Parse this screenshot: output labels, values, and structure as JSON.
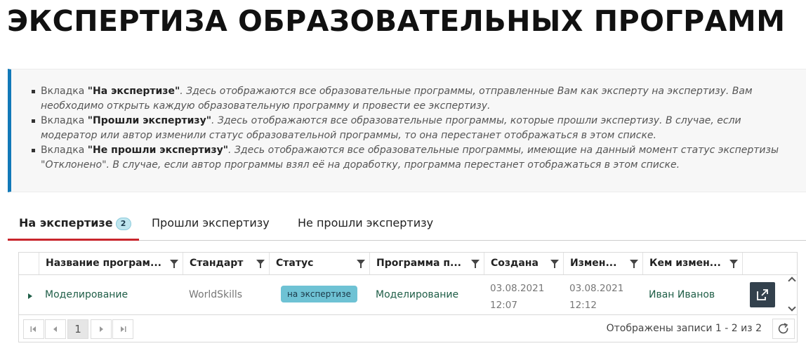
{
  "page": {
    "title": "ЭКСПЕРТИЗА ОБРАЗОВАТЕЛЬНЫХ ПРОГРАММ"
  },
  "info": {
    "items": [
      {
        "prefix": "Вкладка ",
        "bold": "\"На экспертизе\"",
        "text": ". Здесь отображаются все образовательные программы, отправленные Вам как эксперту на экспертизу. Вам необходимо открыть каждую образовательную программу и провести ее экспертизу."
      },
      {
        "prefix": "Вкладка ",
        "bold": "\"Прошли экспертизу\"",
        "text": ". Здесь отображаются все образовательные программы, которые прошли экспертизу. В случае, если модератор или автор изменили статус образовательной программы, то она перестанет отображаться в этом списке."
      },
      {
        "prefix": "Вкладка ",
        "bold": "\"Не прошли экспертизу\"",
        "text": ". Здесь отображаются все образовательные программы, имеющие на данный момент статус экспертизы \"Отклонено\". В случае, если автор программы взял её на доработку, программа перестанет отображаться в этом списке."
      }
    ]
  },
  "tabs": [
    {
      "label": "На экспертизе",
      "count": "2",
      "active": true
    },
    {
      "label": "Прошли экспертизу",
      "active": false
    },
    {
      "label": "Не прошли экспертизу",
      "active": false
    }
  ],
  "grid": {
    "columns": [
      "Название програм...",
      "Стандарт",
      "Статус",
      "Программа п...",
      "Создана",
      "Измен...",
      "Кем измен..."
    ],
    "rows": [
      {
        "name": "Моделирование",
        "standard": "WorldSkills",
        "status": "на экспертизе",
        "program": "Моделирование",
        "created_date": "03.08.2021",
        "created_time": "12:07",
        "modified_date": "03.08.2021",
        "modified_time": "12:12",
        "modified_by": "Иван Иванов"
      }
    ],
    "pager": {
      "current_page": "1",
      "summary": "Отображены записи 1 - 2 из 2"
    }
  },
  "colors": {
    "accent_red": "#c9262c",
    "info_border": "#1279b8",
    "badge": "#6ec2d4",
    "link_green": "#1f5e47",
    "open_button": "#33414d"
  },
  "icons": {
    "expand": "triangle-right-icon",
    "filter": "funnel-icon",
    "open": "external-link-icon",
    "first": "first-page-icon",
    "prev": "prev-page-icon",
    "next": "next-page-icon",
    "last": "last-page-icon",
    "refresh": "refresh-icon"
  }
}
